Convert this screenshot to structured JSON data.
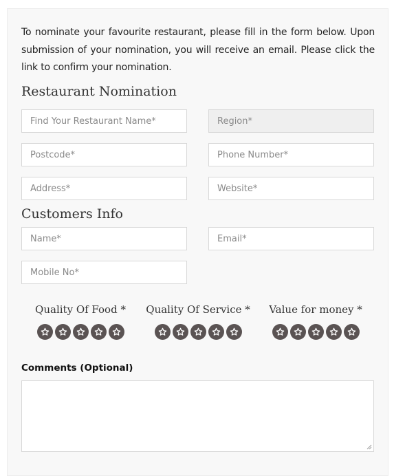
{
  "intro": "To nominate your favourite restaurant, please fill in the form below. Upon submission of your nomination, you will receive an email. Please click the link to confirm your nomination.",
  "restaurant_section": {
    "title": "Restaurant Nomination",
    "restaurant_name_placeholder": "Find Your Restaurant Name*",
    "region_placeholder": "Region*",
    "postcode_placeholder": "Postcode*",
    "phone_placeholder": "Phone Number*",
    "address_placeholder": "Address*",
    "website_placeholder": "Website*"
  },
  "customer_section": {
    "title": "Customers Info",
    "name_placeholder": "Name*",
    "email_placeholder": "Email*",
    "mobile_placeholder": "Mobile No*"
  },
  "ratings": [
    {
      "label": "Quality Of Food *",
      "stars": 5
    },
    {
      "label": "Quality Of Service *",
      "stars": 5
    },
    {
      "label": "Value for money *",
      "stars": 5
    }
  ],
  "comments": {
    "label": "Comments (Optional)",
    "value": ""
  },
  "colors": {
    "star_background": "#5a5353",
    "card_background": "#f8f8f8",
    "disabled_field": "#efefef"
  },
  "icons": {
    "rating_star": "star-outline-icon",
    "resize": "resize-grip-icon"
  }
}
